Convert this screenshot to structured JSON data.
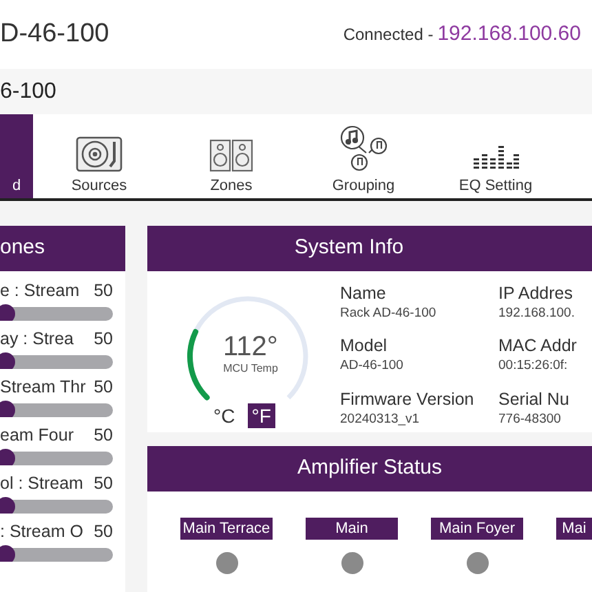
{
  "header": {
    "title": "D-46-100",
    "connection_label": "Connected -",
    "ip": "192.168.100.60"
  },
  "device_bar": {
    "name": "6-100"
  },
  "tabs": [
    {
      "label": "d",
      "kind": "plain",
      "selected": true
    },
    {
      "label": "Sources",
      "kind": "turntable",
      "selected": false
    },
    {
      "label": "Zones",
      "kind": "speakers",
      "selected": false
    },
    {
      "label": "Grouping",
      "kind": "notes",
      "selected": false
    },
    {
      "label": "EQ Setting",
      "kind": "eq",
      "selected": false
    }
  ],
  "zones_panel": {
    "title": "ones",
    "zones": [
      {
        "label": "e : Stream",
        "value": "50",
        "level": 0.5
      },
      {
        "label": "ay : Strea",
        "value": "50",
        "level": 0.5
      },
      {
        "label": "Stream Thr",
        "value": "50",
        "level": 0.5
      },
      {
        "label": "eam Four",
        "value": "50",
        "level": 0.5
      },
      {
        "label": "ol : Stream",
        "value": "50",
        "level": 0.5
      },
      {
        "label": ": Stream O",
        "value": "50",
        "level": 0.5
      }
    ]
  },
  "system_info": {
    "title": "System Info",
    "mcu_temp": {
      "reading": "112°",
      "caption": "MCU Temp",
      "level": 0.26,
      "units": [
        {
          "label": "°C",
          "selected": false
        },
        {
          "label": "°F",
          "selected": true
        }
      ]
    },
    "fields": [
      {
        "label": "Name",
        "value": "Rack AD-46-100"
      },
      {
        "label": "IP Addres",
        "value": "192.168.100."
      },
      {
        "label": "Model",
        "value": "AD-46-100"
      },
      {
        "label": "MAC Addr",
        "value": "00:15:26:0f:"
      },
      {
        "label": "Firmware Version",
        "value": "20240313_v1"
      },
      {
        "label": "Serial Nu",
        "value": "776-48300"
      }
    ]
  },
  "amplifier_status": {
    "title": "Amplifier Status",
    "channels": [
      {
        "label": "Main Terrace",
        "active": false
      },
      {
        "label": "Main",
        "active": false
      },
      {
        "label": "Main Foyer",
        "active": false
      },
      {
        "label": "Mai"
      }
    ]
  }
}
